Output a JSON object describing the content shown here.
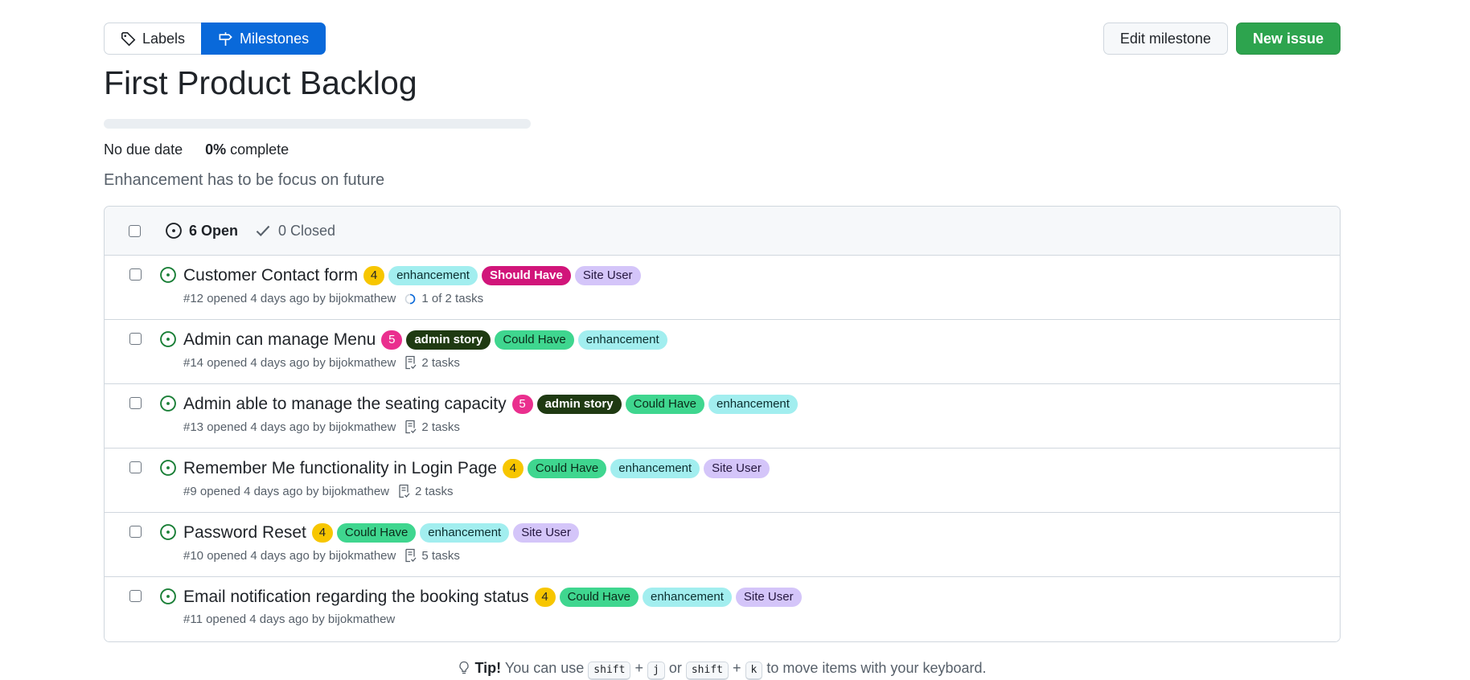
{
  "subnav": {
    "labels": "Labels",
    "milestones": "Milestones"
  },
  "actions": {
    "edit": "Edit milestone",
    "new_issue": "New issue"
  },
  "milestone": {
    "title": "First Product Backlog",
    "progress_percent": 0,
    "due": "No due date",
    "complete_pct": "0%",
    "complete_word": "complete",
    "description": "Enhancement has to be focus on future"
  },
  "header": {
    "open": "6 Open",
    "closed": "0 Closed"
  },
  "colors": {
    "open_icon": "#1a7f37",
    "accent": "#0969da",
    "primary_button": "#2da44e"
  },
  "issues": [
    {
      "title": "Customer Contact form",
      "points": "4",
      "labels": [
        "enhancement",
        "Should Have",
        "Site User"
      ],
      "meta": "#12 opened 4 days ago by bijokmathew",
      "tasks": "1 of 2 tasks",
      "task_icon": "progress-circle-icon"
    },
    {
      "title": "Admin can manage Menu",
      "points": "5",
      "labels": [
        "admin story",
        "Could Have",
        "enhancement"
      ],
      "meta": "#14 opened 4 days ago by bijokmathew",
      "tasks": "2 tasks",
      "task_icon": "checklist-icon"
    },
    {
      "title": "Admin able to manage the seating capacity",
      "points": "5",
      "labels": [
        "admin story",
        "Could Have",
        "enhancement"
      ],
      "meta": "#13 opened 4 days ago by bijokmathew",
      "tasks": "2 tasks",
      "task_icon": "checklist-icon"
    },
    {
      "title": "Remember Me functionality in Login Page",
      "points": "4",
      "labels": [
        "Could Have",
        "enhancement",
        "Site User"
      ],
      "meta": "#9 opened 4 days ago by bijokmathew",
      "tasks": "2 tasks",
      "task_icon": "checklist-icon"
    },
    {
      "title": "Password Reset",
      "points": "4",
      "labels": [
        "Could Have",
        "enhancement",
        "Site User"
      ],
      "meta": "#10 opened 4 days ago by bijokmathew",
      "tasks": "5 tasks",
      "task_icon": "checklist-icon"
    },
    {
      "title": "Email notification regarding the booking status",
      "points": "4",
      "labels": [
        "Could Have",
        "enhancement",
        "Site User"
      ],
      "meta": "#11 opened 4 days ago by bijokmathew",
      "tasks": "",
      "task_icon": ""
    }
  ],
  "tip": {
    "prefix": "Tip!",
    "text1": "You can use",
    "key1": "shift",
    "plus1": "+",
    "key2": "j",
    "or": "or",
    "key3": "shift",
    "plus2": "+",
    "key4": "k",
    "text2": "to move items with your keyboard."
  }
}
